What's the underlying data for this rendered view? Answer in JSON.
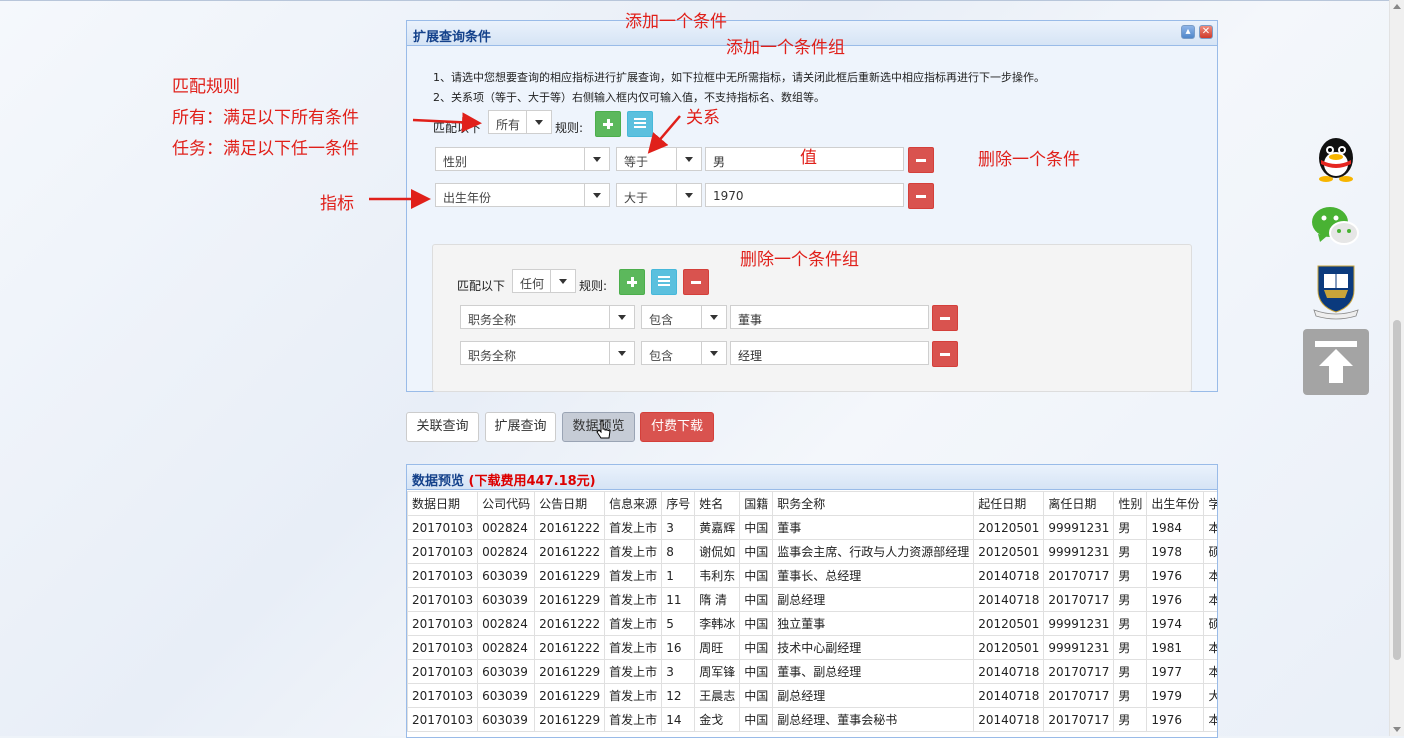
{
  "dialog": {
    "title": "扩展查询条件",
    "tip1": "1、请选中您想要查询的相应指标进行扩展查询，如下拉框中无所需指标，请关闭此框后重新选中相应指标再进行下一步操作。",
    "tip2": "2、关系项（等于、大于等）右侧输入框内仅可输入值，不支持指标名、数组等。",
    "match_label": "匹配以下",
    "match_value": "所有",
    "rule_label": "规则:",
    "conditions": [
      {
        "field": "性别",
        "op": "等于",
        "value": "男"
      },
      {
        "field": "出生年份",
        "op": "大于",
        "value": "1970"
      }
    ],
    "group": {
      "match_label": "匹配以下",
      "match_value": "任何",
      "rule_label": "规则:",
      "conditions": [
        {
          "field": "职务全称",
          "op": "包含",
          "value": "董事"
        },
        {
          "field": "职务全称",
          "op": "包含",
          "value": "经理"
        }
      ]
    }
  },
  "toolbar": {
    "assoc_query": "关联查询",
    "ext_query": "扩展查询",
    "data_preview": "数据预览",
    "paid_download": "付费下载"
  },
  "preview": {
    "title": "数据预览",
    "fee": "(下载费用447.18元)",
    "columns": [
      "数据日期",
      "公司代码",
      "公告日期",
      "信息来源",
      "序号",
      "姓名",
      "国籍",
      "职务全称",
      "起任日期",
      "离任日期",
      "性别",
      "出生年份",
      "学历"
    ],
    "rows": [
      [
        "20170103",
        "002824",
        "20161222",
        "首发上市",
        "3",
        "黄嘉辉",
        "中国",
        "董事",
        "20120501",
        "99991231",
        "男",
        "1984",
        "本科"
      ],
      [
        "20170103",
        "002824",
        "20161222",
        "首发上市",
        "8",
        "谢侃如",
        "中国",
        "监事会主席、行政与人力资源部经理",
        "20120501",
        "99991231",
        "男",
        "1978",
        "硕士"
      ],
      [
        "20170103",
        "603039",
        "20161229",
        "首发上市",
        "1",
        "韦利东",
        "中国",
        "董事长、总经理",
        "20140718",
        "20170717",
        "男",
        "1976",
        "本科"
      ],
      [
        "20170103",
        "603039",
        "20161229",
        "首发上市",
        "11",
        "隋 清",
        "中国",
        "副总经理",
        "20140718",
        "20170717",
        "男",
        "1976",
        "本科"
      ],
      [
        "20170103",
        "002824",
        "20161222",
        "首发上市",
        "5",
        "李韩冰",
        "中国",
        "独立董事",
        "20120501",
        "99991231",
        "男",
        "1974",
        "硕士"
      ],
      [
        "20170103",
        "002824",
        "20161222",
        "首发上市",
        "16",
        "周旺",
        "中国",
        "技术中心副经理",
        "20120501",
        "99991231",
        "男",
        "1981",
        "本科"
      ],
      [
        "20170103",
        "603039",
        "20161229",
        "首发上市",
        "3",
        "周军锋",
        "中国",
        "董事、副总经理",
        "20140718",
        "20170717",
        "男",
        "1977",
        "本科"
      ],
      [
        "20170103",
        "603039",
        "20161229",
        "首发上市",
        "12",
        "王晨志",
        "中国",
        "副总经理",
        "20140718",
        "20170717",
        "男",
        "1979",
        "大专"
      ],
      [
        "20170103",
        "603039",
        "20161229",
        "首发上市",
        "14",
        "金戈",
        "中国",
        "副总经理、董事会秘书",
        "20140718",
        "20170717",
        "男",
        "1976",
        "本科"
      ]
    ]
  },
  "annotations": {
    "add_condition": "添加一个条件",
    "add_group": "添加一个条件组",
    "match_rule_title": "匹配规则",
    "match_all": "所有：满足以下所有条件",
    "match_any": "任务：满足以下任一条件",
    "relation": "关系",
    "value": "值",
    "delete_condition": "删除一个条件",
    "indicator": "指标",
    "delete_group": "删除一个条件组"
  },
  "colors": {
    "annotation": "#e0201a",
    "accent_red": "#d9534f",
    "accent_green": "#5cb85c",
    "accent_blue": "#5bc0de"
  },
  "icons": [
    "qq-icon",
    "wechat-icon",
    "emblem-icon",
    "back-to-top-icon",
    "cursor-icon"
  ]
}
